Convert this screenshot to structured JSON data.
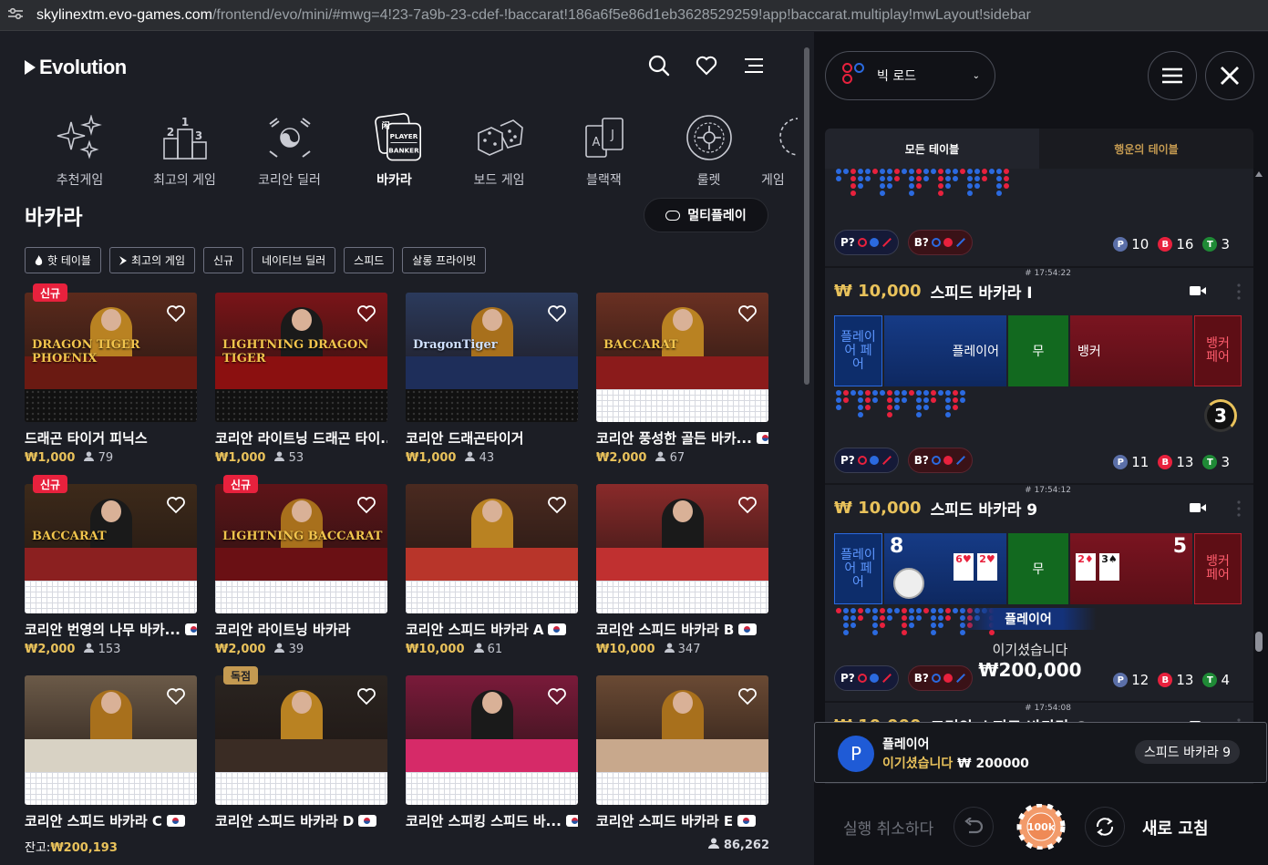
{
  "browser": {
    "host": "skylinextm.evo-games.com",
    "path": "/frontend/evo/mini/#mwg=4!23-7a9b-23-cdef-!baccarat!186a6f5e86d1eb3628529259!app!baccarat.multiplay!mwLayout!sidebar"
  },
  "lobby": {
    "brand": "Evolution",
    "categories": [
      {
        "label": "추천게임",
        "icon": "sparkles-icon"
      },
      {
        "label": "최고의 게임",
        "icon": "podium-icon"
      },
      {
        "label": "코리안 딜러",
        "icon": "korean-flag-icon"
      },
      {
        "label": "바카라",
        "icon": "player-banker-icon"
      },
      {
        "label": "보드 게임",
        "icon": "dice-icon"
      },
      {
        "label": "블랙잭",
        "icon": "cards-icon"
      },
      {
        "label": "룰렛",
        "icon": "roulette-icon"
      },
      {
        "label": "게임",
        "icon": "game-icon"
      }
    ],
    "section_title": "바카라",
    "multiplay_label": "멀티플레이",
    "filters": [
      "핫 테이블",
      "최고의 게임",
      "신규",
      "네이티브 딜러",
      "스피드",
      "살롱 프라이빗"
    ],
    "games": [
      {
        "name": "드래곤 타이거 피닉스",
        "bet": "₩1,000",
        "players": "79",
        "badge": "신규",
        "logo": "DRAGON TIGER PHOENIX",
        "flag": false,
        "bg": "#5b2a1c"
      },
      {
        "name": "코리안 라이트닝 드래곤 타이...",
        "bet": "₩1,000",
        "players": "53",
        "badge": "",
        "logo": "LIGHTNING DRAGON TIGER",
        "flag": false,
        "bg": "#7a1418"
      },
      {
        "name": "코리안 드래곤타이거",
        "bet": "₩1,000",
        "players": "43",
        "badge": "",
        "logo": "DragonTiger",
        "flag": false,
        "bg": "#2b3a5c"
      },
      {
        "name": "코리안 풍성한 골든 바카...",
        "bet": "₩2,000",
        "players": "67",
        "badge": "",
        "logo": "BACCARAT",
        "flag": true,
        "bg": "#6a3022"
      },
      {
        "name": "코리안 번영의 나무 바카...",
        "bet": "₩2,000",
        "players": "153",
        "badge": "신규",
        "logo": "BACCARAT",
        "flag": true,
        "bg": "#3d2a1a"
      },
      {
        "name": "코리안 라이트닝 바카라",
        "bet": "₩2,000",
        "players": "39",
        "badge": "신규",
        "logo": "LIGHTNING BACCARAT",
        "flag": false,
        "bg": "#5e1418"
      },
      {
        "name": "코리안 스피드 바카라 A",
        "bet": "₩10,000",
        "players": "61",
        "badge": "",
        "logo": "",
        "flag": true,
        "bg": "#4a2a20"
      },
      {
        "name": "코리안 스피드 바카라 B",
        "bet": "₩10,000",
        "players": "347",
        "badge": "",
        "logo": "",
        "flag": true,
        "bg": "#8a2a2a"
      },
      {
        "name": "코리안 스피드 바카라 C",
        "bet": "",
        "players": "",
        "badge": "",
        "logo": "",
        "flag": true,
        "bg": "#6b5a48"
      },
      {
        "name": "코리안 스피드 바카라 D",
        "bet": "",
        "players": "",
        "badge": "독점",
        "logo": "",
        "flag": true,
        "bg": "#2a2420"
      },
      {
        "name": "코리안 스피킹 스피드 바...",
        "bet": "",
        "players": "",
        "badge": "",
        "logo": "",
        "flag": true,
        "bg": "#7a1a3a"
      },
      {
        "name": "코리안 스피드 바카라 E",
        "bet": "",
        "players": "",
        "badge": "",
        "logo": "",
        "flag": true,
        "bg": "#6a4a34"
      }
    ],
    "balance_label": "잔고:",
    "balance_value": "₩200,193",
    "total_players": "86,262"
  },
  "sidebar": {
    "road_label": "빅 로드",
    "tab_all": "모든 테이블",
    "tab_lucky": "행운의 테이블",
    "top_stats": {
      "p": "10",
      "b": "16",
      "t": "3"
    },
    "pred_p": "P?",
    "pred_b": "B?",
    "tables": [
      {
        "time": "# 17:54:22",
        "amount": "₩ 10,000",
        "name": "스피드 바카라 I",
        "stats": {
          "p": "11",
          "b": "13",
          "t": "3"
        },
        "timer": "3"
      },
      {
        "time": "# 17:54:12",
        "amount": "₩ 10,000",
        "name": "스피드 바카라 9",
        "stats": {
          "p": "12",
          "b": "13",
          "t": "4"
        },
        "player_score": "8",
        "banker_score": "5",
        "player_cards": [
          "6♥",
          "2♥"
        ],
        "banker_cards": [
          "2♦",
          "3♠"
        ]
      },
      {
        "time": "# 17:54:08",
        "amount": "₩ 10,000",
        "name": "코리안 스피드 바카라 Q"
      }
    ],
    "bet_labels": {
      "player_pair": "플레이어 페어",
      "player": "플레이어",
      "tie": "무",
      "banker": "뱅커",
      "banker_pair": "뱅커 페어"
    },
    "win_label": "플레이어",
    "win_text": "이기셨습니다",
    "win_amount": "₩200,000",
    "toast": {
      "avatar": "P",
      "title": "플레이어",
      "won": "이기셨습니다",
      "amount": "₩ 200000",
      "table": "스피드 바카라 9"
    },
    "undo_label": "실행 취소하다",
    "chip_label": "100k",
    "refresh_label": "새로 고침",
    "colors": {
      "gold": "#e9c25b",
      "player": "#2b6ae0",
      "banker": "#e8213d",
      "tie": "#12691f"
    }
  }
}
